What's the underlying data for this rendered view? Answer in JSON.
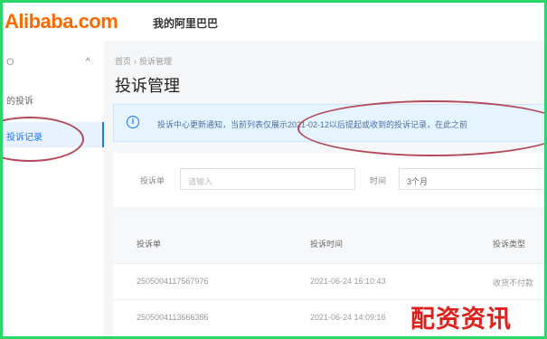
{
  "header": {
    "logo_text": "Alibaba.com",
    "subtitle": "我的阿里巴巴"
  },
  "sidebar": {
    "head": "O",
    "items": [
      {
        "label": "的投诉",
        "active": false
      },
      {
        "label": "投诉记录",
        "active": true
      }
    ]
  },
  "breadcrumb": {
    "home": "首页",
    "sep": "›",
    "current": "投诉管理"
  },
  "page_title": "投诉管理",
  "notice": {
    "icon": "info-icon",
    "text": "投诉中心更新通知，当前列表仅展示2021-02-12以后提起或收到的投诉记录，在此之前"
  },
  "filter": {
    "no_label": "投诉单",
    "no_placeholder": "请输入",
    "time_label": "时间",
    "time_value": "3个月"
  },
  "table": {
    "headers": [
      "投诉单",
      "投诉时间",
      "投诉类型"
    ],
    "rows": [
      [
        "2505004117567976",
        "2021-06-24 16:10:43",
        "收货不付款"
      ],
      [
        "2505004113666386",
        "2021-06-24 14:09:16",
        ""
      ]
    ]
  },
  "annotations": {
    "color": "#b24a5a"
  },
  "watermark": "配资资讯"
}
